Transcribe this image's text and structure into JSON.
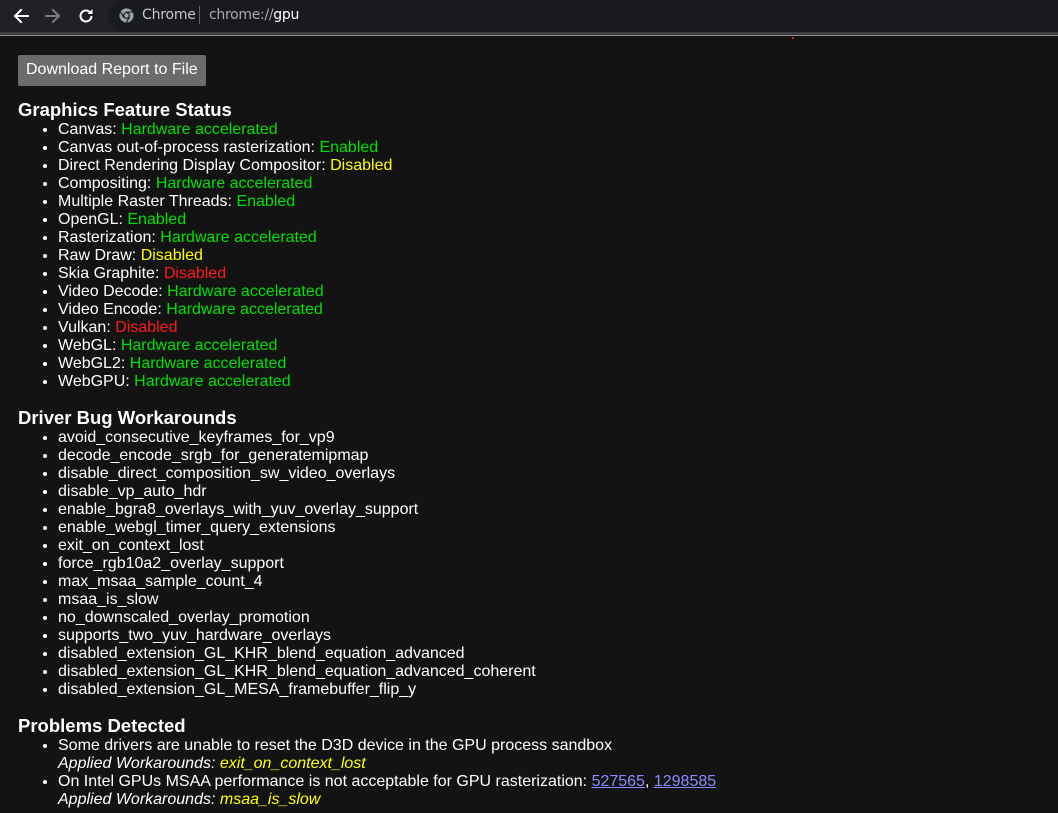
{
  "browser": {
    "site_label": "Chrome",
    "url_scheme": "chrome://",
    "url_host": "gpu",
    "icons": {
      "back": "arrow-left",
      "forward": "arrow-right",
      "reload": "reload",
      "site": "chrome-logo"
    }
  },
  "page": {
    "download_button": "Download Report to File",
    "graphics_feature_status": {
      "title": "Graphics Feature Status",
      "items": [
        {
          "name": "Canvas",
          "status": "Hardware accelerated",
          "color": "#00e000"
        },
        {
          "name": "Canvas out-of-process rasterization",
          "status": "Enabled",
          "color": "#00e000"
        },
        {
          "name": "Direct Rendering Display Compositor",
          "status": "Disabled",
          "color": "#ffff00"
        },
        {
          "name": "Compositing",
          "status": "Hardware accelerated",
          "color": "#00e000"
        },
        {
          "name": "Multiple Raster Threads",
          "status": "Enabled",
          "color": "#00e000"
        },
        {
          "name": "OpenGL",
          "status": "Enabled",
          "color": "#00e000"
        },
        {
          "name": "Rasterization",
          "status": "Hardware accelerated",
          "color": "#00e000"
        },
        {
          "name": "Raw Draw",
          "status": "Disabled",
          "color": "#ffff00"
        },
        {
          "name": "Skia Graphite",
          "status": "Disabled",
          "color": "#ff1a1a"
        },
        {
          "name": "Video Decode",
          "status": "Hardware accelerated",
          "color": "#00e000"
        },
        {
          "name": "Video Encode",
          "status": "Hardware accelerated",
          "color": "#00e000"
        },
        {
          "name": "Vulkan",
          "status": "Disabled",
          "color": "#ff1a1a"
        },
        {
          "name": "WebGL",
          "status": "Hardware accelerated",
          "color": "#00e000"
        },
        {
          "name": "WebGL2",
          "status": "Hardware accelerated",
          "color": "#00e000"
        },
        {
          "name": "WebGPU",
          "status": "Hardware accelerated",
          "color": "#00e000"
        }
      ]
    },
    "driver_bug_workarounds": {
      "title": "Driver Bug Workarounds",
      "items": [
        "avoid_consecutive_keyframes_for_vp9",
        "decode_encode_srgb_for_generatemipmap",
        "disable_direct_composition_sw_video_overlays",
        "disable_vp_auto_hdr",
        "enable_bgra8_overlays_with_yuv_overlay_support",
        "enable_webgl_timer_query_extensions",
        "exit_on_context_lost",
        "force_rgb10a2_overlay_support",
        "max_msaa_sample_count_4",
        "msaa_is_slow",
        "no_downscaled_overlay_promotion",
        "supports_two_yuv_hardware_overlays",
        "disabled_extension_GL_KHR_blend_equation_advanced",
        "disabled_extension_GL_KHR_blend_equation_advanced_coherent",
        "disabled_extension_GL_MESA_framebuffer_flip_y"
      ]
    },
    "problems_detected": {
      "title": "Problems Detected",
      "applied_label": "Applied Workarounds: ",
      "items": [
        {
          "text": "Some drivers are unable to reset the D3D device in the GPU process sandbox",
          "links": [],
          "workarounds": "exit_on_context_lost"
        },
        {
          "text": "On Intel GPUs MSAA performance is not acceptable for GPU rasterization: ",
          "links": [
            "527565",
            "1298585"
          ],
          "workarounds": "msaa_is_slow"
        }
      ]
    }
  }
}
